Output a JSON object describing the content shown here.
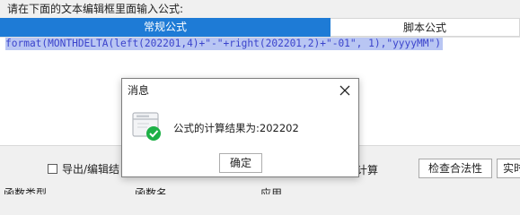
{
  "prompt": "请在下面的文本编辑框里面输入公式:",
  "tabs": [
    {
      "label": "常规公式",
      "active": true
    },
    {
      "label": "脚本公式",
      "active": false
    }
  ],
  "editor": {
    "formula": "format(MONTHDELTA(left(202201,4)+\"-\"+right(202201,2)+\"-01\", 1),\"yyyyMM\")"
  },
  "bottom": {
    "checkbox_label": "导出/编辑结",
    "partial_text": "计算",
    "check_button": "检查合法性",
    "more_button": "实时",
    "row_labels": [
      "函数类型",
      "函数名",
      "应用"
    ]
  },
  "dialog": {
    "title": "消息",
    "message": "公式的计算结果为:202202",
    "ok_label": "确定"
  },
  "colors": {
    "tab_active": "#1e7bd6",
    "selection": "#b9c6f3",
    "formula_text": "#3b44cc",
    "success_green": "#1db046"
  }
}
